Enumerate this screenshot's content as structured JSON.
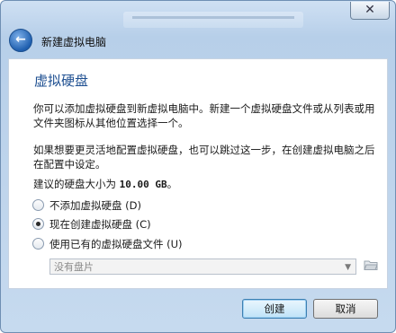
{
  "window": {
    "close_glyph": "✕"
  },
  "nav": {
    "back_glyph": "←",
    "title": "新建虚拟电脑"
  },
  "page": {
    "heading": "虚拟硬盘",
    "paragraph1": "你可以添加虚拟硬盘到新虚拟电脑中。新建一个虚拟硬盘文件或从列表或用文件夹图标从其他位置选择一个。",
    "paragraph2": "如果想要更灵活地配置虚拟硬盘，也可以跳过这一步，在创建虚拟电脑之后在配置中设定。",
    "recommended_prefix": "建议的硬盘大小为 ",
    "recommended_size": "10.00 GB",
    "recommended_suffix": "。"
  },
  "options": [
    {
      "label": "不添加虚拟硬盘 (D)",
      "checked": false
    },
    {
      "label": "现在创建虚拟硬盘 (C)",
      "checked": true
    },
    {
      "label": "使用已有的虚拟硬盘文件 (U)",
      "checked": false
    }
  ],
  "existing_disk": {
    "selected": "没有盘片",
    "enabled": false
  },
  "buttons": {
    "create": "创建",
    "cancel": "取消"
  }
}
